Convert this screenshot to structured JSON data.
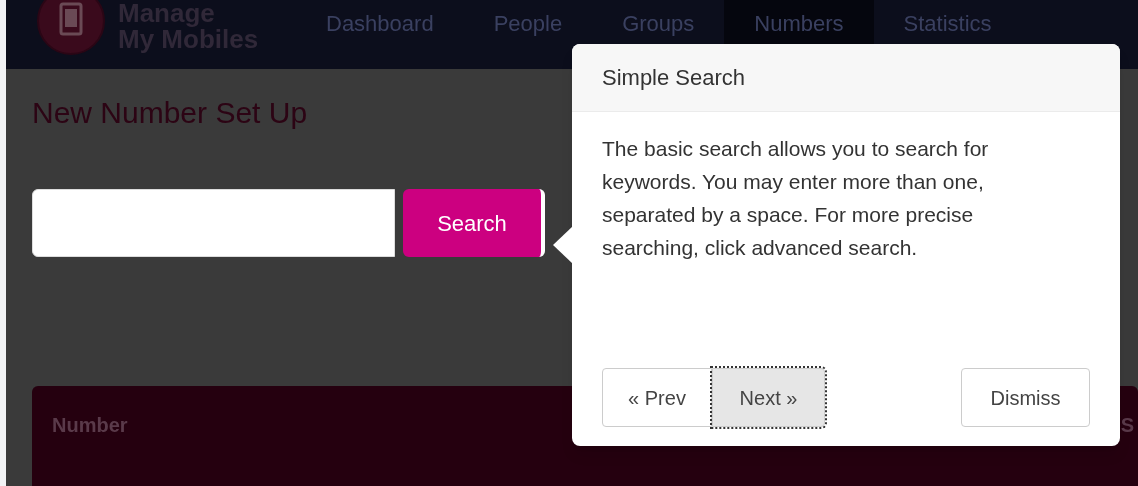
{
  "app": {
    "logo_text": [
      "Manage",
      "My Mobiles"
    ]
  },
  "nav": [
    {
      "label": "Dashboard",
      "selected": false
    },
    {
      "label": "People",
      "selected": false
    },
    {
      "label": "Groups",
      "selected": false
    },
    {
      "label": "Numbers",
      "selected": true
    },
    {
      "label": "Statistics",
      "selected": false
    }
  ],
  "page": {
    "title": "New Number Set Up",
    "search_button": "Search"
  },
  "table": {
    "columns": [
      "Number",
      "S"
    ]
  },
  "popover": {
    "title": "Simple Search",
    "body": "The basic search allows you to search for keywords. You may enter more than one, separated by a space. For more precise searching, click advanced search.",
    "buttons": [
      {
        "label": "« Prev",
        "kind": "prev",
        "focused": false
      },
      {
        "label": "Next »",
        "kind": "next",
        "focused": true
      },
      {
        "label": "Dismiss",
        "kind": "dismiss",
        "focused": false
      }
    ]
  }
}
